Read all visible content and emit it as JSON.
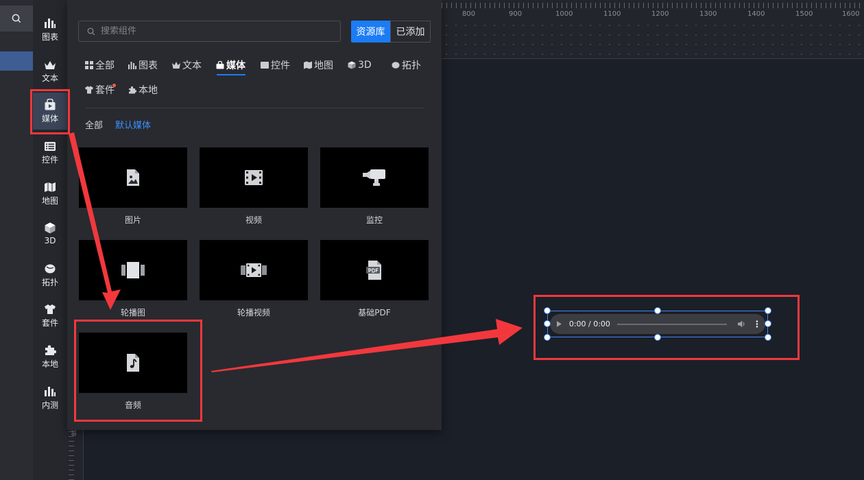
{
  "nav": {
    "items": [
      {
        "label": "图表",
        "icon": "bar-chart-icon"
      },
      {
        "label": "文本",
        "icon": "crown-text-icon"
      },
      {
        "label": "媒体",
        "icon": "media-bag-icon"
      },
      {
        "label": "控件",
        "icon": "list-control-icon"
      },
      {
        "label": "地图",
        "icon": "map-icon"
      },
      {
        "label": "3D",
        "icon": "cube-icon"
      },
      {
        "label": "拓扑",
        "icon": "topology-icon"
      },
      {
        "label": "套件",
        "icon": "shirt-kit-icon"
      },
      {
        "label": "本地",
        "icon": "puzzle-icon"
      },
      {
        "label": "内测",
        "icon": "bar-chart-icon"
      }
    ],
    "active": "媒体"
  },
  "ruler": {
    "top_labels": [
      "800",
      "900",
      "1000",
      "1100",
      "1200",
      "1300",
      "1400",
      "1500",
      "1600"
    ],
    "left_label": "800"
  },
  "panel": {
    "search_placeholder": "搜索组件",
    "btn_library": "资源库",
    "btn_added": "已添加",
    "categories": [
      "全部",
      "图表",
      "文本",
      "媒体",
      "控件",
      "地图",
      "3D",
      "拓扑",
      "套件",
      "本地"
    ],
    "active_category": "媒体",
    "sub_filters": [
      "全部",
      "默认媒体"
    ],
    "cards": [
      {
        "label": "图片",
        "icon": "image-file-icon"
      },
      {
        "label": "视频",
        "icon": "film-icon"
      },
      {
        "label": "监控",
        "icon": "camera-icon"
      },
      {
        "label": "轮播图",
        "icon": "carousel-icon"
      },
      {
        "label": "轮播视频",
        "icon": "film-strip-icon"
      },
      {
        "label": "基础PDF",
        "icon": "pdf-icon"
      },
      {
        "label": "音频",
        "icon": "music-file-icon"
      }
    ]
  },
  "audio": {
    "time": "0:00 / 0:00"
  },
  "colors": {
    "accent": "#1c7cf5",
    "annotation": "#f2383d",
    "selection": "#3f87f5"
  }
}
